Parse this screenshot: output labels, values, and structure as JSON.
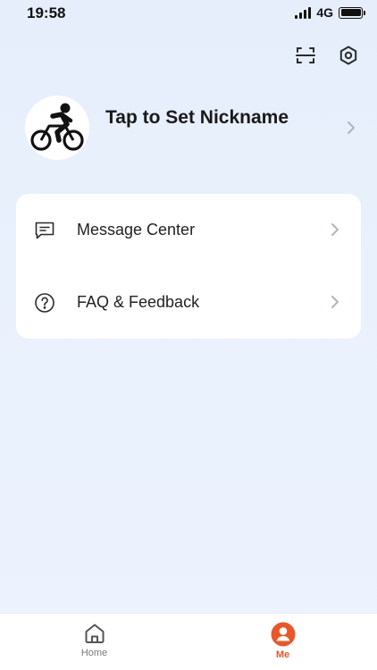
{
  "status_bar": {
    "time": "19:58",
    "network": "4G"
  },
  "top_actions": {
    "scan_icon": "scan-icon",
    "settings_icon": "hexagon-settings-icon"
  },
  "profile": {
    "avatar_icon": "cyclist-icon",
    "nickname": "Tap to Set Nickname"
  },
  "menu": {
    "items": [
      {
        "label": "Message Center",
        "icon": "message-icon"
      },
      {
        "label": "FAQ & Feedback",
        "icon": "question-circle-icon"
      }
    ]
  },
  "tab_bar": {
    "tabs": [
      {
        "label": "Home",
        "icon": "home-icon",
        "active": false
      },
      {
        "label": "Me",
        "icon": "user-icon",
        "active": true
      }
    ]
  },
  "colors": {
    "accent": "#e8572a",
    "background": "#e9f1fd",
    "card": "#ffffff"
  }
}
